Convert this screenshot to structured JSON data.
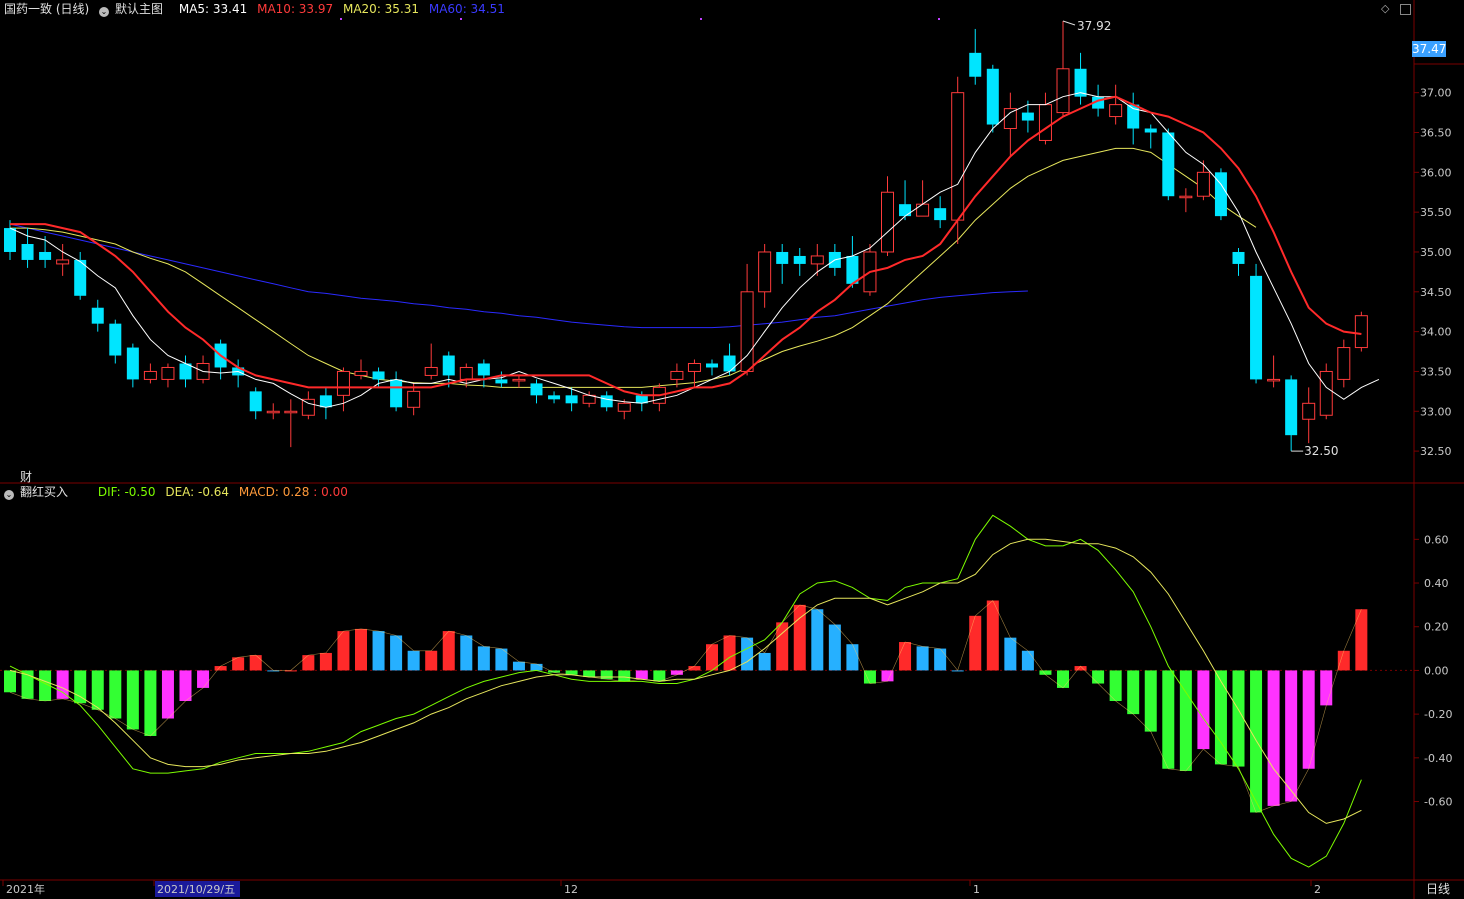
{
  "header": {
    "title": "国药一致 (日线)",
    "template": "默认主图",
    "ma5": "MA5: 33.41",
    "ma10": "MA10: 33.97",
    "ma20": "MA20: 35.31",
    "ma60": "MA60: 34.51"
  },
  "sub_header": {
    "indicator": "翻红买入",
    "dif": "DIF: -0.50",
    "dea": "DEA: -0.64",
    "macd": "MACD: 0.28",
    "extra": ": 0.00"
  },
  "current_price_tag": "37.47",
  "cai_label": "财",
  "annotations": {
    "high": "37.92",
    "low": "32.50"
  },
  "period_label": "日线",
  "date_axis": [
    "2021年",
    "2021/10/29/五",
    "12",
    "1",
    "2"
  ],
  "colors": {
    "up": "#ff3b3b",
    "down": "#00e5ff",
    "ma5": "#ffffff",
    "ma10": "#ff2a2a",
    "ma20": "#e6e65c",
    "ma60": "#2a2aff",
    "grid": "#7a0000",
    "dif": "#7cfc00",
    "dea": "#e6e65c",
    "macd_pos": "#ff2a2a",
    "macd_pos_dim": "#26b0ff",
    "macd_neg": "#33ff33",
    "macd_neg_dim": "#ff33ff"
  },
  "chart_data": [
    {
      "type": "candlestick",
      "title": "国药一致 (日线)",
      "y_ticks": [
        "37.00",
        "36.50",
        "36.00",
        "35.50",
        "35.00",
        "34.50",
        "34.00",
        "33.50",
        "33.00",
        "32.50"
      ],
      "ylim": [
        32.2,
        37.95
      ],
      "candles": [
        [
          35.3,
          35.0,
          35.4,
          34.9
        ],
        [
          35.1,
          34.9,
          35.3,
          34.8
        ],
        [
          35.0,
          34.9,
          35.2,
          34.8
        ],
        [
          34.85,
          34.9,
          35.1,
          34.7
        ],
        [
          34.9,
          34.45,
          35.0,
          34.4
        ],
        [
          34.3,
          34.1,
          34.4,
          34.0
        ],
        [
          34.1,
          33.7,
          34.15,
          33.6
        ],
        [
          33.8,
          33.4,
          33.85,
          33.3
        ],
        [
          33.4,
          33.5,
          33.6,
          33.35
        ],
        [
          33.4,
          33.55,
          33.6,
          33.3
        ],
        [
          33.6,
          33.4,
          33.7,
          33.3
        ],
        [
          33.4,
          33.6,
          33.7,
          33.35
        ],
        [
          33.85,
          33.55,
          33.9,
          33.4
        ],
        [
          33.55,
          33.45,
          33.65,
          33.3
        ],
        [
          33.25,
          33.0,
          33.3,
          32.9
        ],
        [
          33.0,
          33.0,
          33.1,
          32.9
        ],
        [
          33.0,
          33.0,
          33.15,
          32.55
        ],
        [
          32.95,
          33.15,
          33.25,
          32.9
        ],
        [
          33.2,
          33.05,
          33.3,
          32.9
        ],
        [
          33.2,
          33.5,
          33.55,
          33.0
        ],
        [
          33.45,
          33.5,
          33.65,
          33.4
        ],
        [
          33.5,
          33.4,
          33.55,
          33.3
        ],
        [
          33.4,
          33.05,
          33.5,
          33.0
        ],
        [
          33.05,
          33.25,
          33.35,
          32.95
        ],
        [
          33.45,
          33.55,
          33.85,
          33.4
        ],
        [
          33.7,
          33.45,
          33.75,
          33.3
        ],
        [
          33.4,
          33.55,
          33.6,
          33.3
        ],
        [
          33.6,
          33.45,
          33.65,
          33.3
        ],
        [
          33.4,
          33.35,
          33.5,
          33.3
        ],
        [
          33.4,
          33.4,
          33.45,
          33.3
        ],
        [
          33.35,
          33.2,
          33.4,
          33.1
        ],
        [
          33.2,
          33.15,
          33.25,
          33.1
        ],
        [
          33.2,
          33.1,
          33.3,
          33.0
        ],
        [
          33.1,
          33.2,
          33.25,
          33.05
        ],
        [
          33.2,
          33.05,
          33.25,
          33.0
        ],
        [
          33.0,
          33.1,
          33.15,
          32.9
        ],
        [
          33.2,
          33.1,
          33.25,
          33.0
        ],
        [
          33.1,
          33.3,
          33.35,
          33.0
        ],
        [
          33.4,
          33.5,
          33.6,
          33.3
        ],
        [
          33.5,
          33.6,
          33.65,
          33.3
        ],
        [
          33.6,
          33.55,
          33.65,
          33.45
        ],
        [
          33.7,
          33.5,
          33.85,
          33.45
        ],
        [
          33.5,
          34.5,
          34.85,
          33.45
        ],
        [
          34.5,
          35.0,
          35.1,
          34.3
        ],
        [
          35.0,
          34.85,
          35.1,
          34.6
        ],
        [
          34.95,
          34.85,
          35.05,
          34.7
        ],
        [
          34.85,
          34.95,
          35.1,
          34.7
        ],
        [
          35.0,
          34.8,
          35.1,
          34.7
        ],
        [
          34.95,
          34.6,
          35.2,
          34.55
        ],
        [
          34.5,
          35.0,
          35.1,
          34.45
        ],
        [
          35.0,
          35.75,
          35.95,
          34.95
        ],
        [
          35.6,
          35.45,
          35.9,
          35.4
        ],
        [
          35.45,
          35.6,
          35.9,
          35.45
        ],
        [
          35.55,
          35.4,
          35.7,
          35.3
        ],
        [
          35.4,
          37.0,
          37.2,
          35.1
        ],
        [
          37.5,
          37.2,
          37.8,
          37.1
        ],
        [
          37.3,
          36.6,
          37.35,
          36.5
        ],
        [
          36.55,
          36.8,
          37.0,
          36.2
        ],
        [
          36.75,
          36.65,
          36.9,
          36.5
        ],
        [
          36.4,
          36.85,
          37.0,
          36.35
        ],
        [
          36.75,
          37.3,
          37.9,
          36.7
        ],
        [
          37.3,
          36.95,
          37.5,
          36.85
        ],
        [
          36.95,
          36.8,
          37.1,
          36.7
        ],
        [
          36.7,
          36.85,
          37.1,
          36.6
        ],
        [
          36.85,
          36.55,
          37.0,
          36.35
        ],
        [
          36.55,
          36.5,
          36.6,
          36.3
        ],
        [
          36.5,
          35.7,
          36.55,
          35.65
        ],
        [
          35.7,
          35.7,
          35.8,
          35.5
        ],
        [
          35.7,
          36.0,
          36.15,
          35.65
        ],
        [
          36.0,
          35.45,
          36.05,
          35.4
        ],
        [
          35.0,
          34.85,
          35.05,
          34.7
        ],
        [
          34.7,
          33.4,
          34.85,
          33.35
        ],
        [
          33.4,
          33.4,
          33.7,
          33.3
        ],
        [
          33.4,
          32.7,
          33.45,
          32.5
        ],
        [
          32.9,
          33.1,
          33.3,
          32.6
        ],
        [
          32.95,
          33.5,
          33.6,
          32.9
        ],
        [
          33.4,
          33.8,
          33.9,
          33.3
        ],
        [
          33.8,
          34.2,
          34.25,
          33.75
        ]
      ],
      "ma5": [
        35.3,
        35.2,
        35.15,
        35.0,
        34.88,
        34.7,
        34.55,
        34.2,
        33.9,
        33.7,
        33.6,
        33.5,
        33.48,
        33.5,
        33.4,
        33.35,
        33.22,
        33.1,
        33.05,
        33.1,
        33.2,
        33.35,
        33.4,
        33.35,
        33.35,
        33.4,
        33.35,
        33.4,
        33.42,
        33.5,
        33.42,
        33.35,
        33.28,
        33.2,
        33.15,
        33.12,
        33.1,
        33.15,
        33.2,
        33.3,
        33.4,
        33.5,
        33.7,
        34.0,
        34.3,
        34.55,
        34.75,
        34.9,
        34.95,
        35.05,
        35.25,
        35.45,
        35.6,
        35.75,
        35.85,
        36.25,
        36.55,
        36.75,
        36.85,
        36.85,
        36.95,
        37.0,
        36.95,
        36.95,
        36.8,
        36.75,
        36.5,
        36.25,
        36.1,
        35.85,
        35.5,
        35.0,
        34.55,
        34.1,
        33.6,
        33.3,
        33.15,
        33.3,
        33.4
      ],
      "ma10": [
        35.35,
        35.35,
        35.35,
        35.3,
        35.25,
        35.1,
        34.95,
        34.75,
        34.5,
        34.25,
        34.05,
        33.9,
        33.7,
        33.55,
        33.45,
        33.4,
        33.35,
        33.3,
        33.3,
        33.3,
        33.3,
        33.3,
        33.3,
        33.3,
        33.3,
        33.35,
        33.4,
        33.4,
        33.45,
        33.45,
        33.45,
        33.45,
        33.45,
        33.45,
        33.35,
        33.25,
        33.2,
        33.2,
        33.25,
        33.3,
        33.3,
        33.35,
        33.5,
        33.7,
        33.9,
        34.05,
        34.25,
        34.4,
        34.6,
        34.75,
        34.8,
        34.9,
        34.95,
        35.1,
        35.4,
        35.7,
        35.95,
        36.2,
        36.4,
        36.55,
        36.7,
        36.8,
        36.9,
        36.95,
        36.85,
        36.75,
        36.7,
        36.6,
        36.5,
        36.3,
        36.05,
        35.7,
        35.25,
        34.75,
        34.3,
        34.1,
        34.0,
        33.97
      ],
      "ma20": [
        35.3,
        35.3,
        35.28,
        35.25,
        35.2,
        35.15,
        35.1,
        35.0,
        34.92,
        34.85,
        34.75,
        34.6,
        34.45,
        34.3,
        34.15,
        34.0,
        33.85,
        33.7,
        33.6,
        33.5,
        33.45,
        33.4,
        33.38,
        33.36,
        33.35,
        33.35,
        33.33,
        33.32,
        33.3,
        33.3,
        33.3,
        33.3,
        33.3,
        33.3,
        33.3,
        33.3,
        33.3,
        33.32,
        33.34,
        33.36,
        33.4,
        33.45,
        33.55,
        33.65,
        33.75,
        33.82,
        33.88,
        33.95,
        34.05,
        34.2,
        34.35,
        34.55,
        34.75,
        34.95,
        35.15,
        35.4,
        35.6,
        35.8,
        35.95,
        36.05,
        36.15,
        36.2,
        36.25,
        36.3,
        36.3,
        36.25,
        36.1,
        35.95,
        35.8,
        35.6,
        35.45,
        35.31
      ],
      "ma60": [
        35.35,
        35.3,
        35.25,
        35.2,
        35.15,
        35.1,
        35.05,
        35.0,
        34.95,
        34.9,
        34.85,
        34.8,
        34.75,
        34.7,
        34.65,
        34.6,
        34.55,
        34.5,
        34.48,
        34.45,
        34.42,
        34.4,
        34.38,
        34.35,
        34.33,
        34.3,
        34.28,
        34.25,
        34.23,
        34.2,
        34.18,
        34.15,
        34.12,
        34.1,
        34.08,
        34.06,
        34.05,
        34.05,
        34.05,
        34.05,
        34.05,
        34.06,
        34.08,
        34.1,
        34.12,
        34.15,
        34.18,
        34.2,
        34.24,
        34.28,
        34.32,
        34.36,
        34.4,
        34.43,
        34.45,
        34.47,
        34.49,
        34.5,
        34.51
      ]
    },
    {
      "type": "macd",
      "y_ticks": [
        "0.60",
        "0.40",
        "0.20",
        "0.00",
        "-0.20",
        "-0.40",
        "-0.60"
      ],
      "ylim": [
        -0.95,
        0.78
      ],
      "macd": [
        -0.1,
        -0.13,
        -0.14,
        -0.13,
        -0.15,
        -0.18,
        -0.22,
        -0.27,
        -0.3,
        -0.22,
        -0.14,
        -0.08,
        0.02,
        0.06,
        0.07,
        0.0,
        0.0,
        0.07,
        0.08,
        0.18,
        0.19,
        0.18,
        0.16,
        0.09,
        0.09,
        0.18,
        0.16,
        0.11,
        0.1,
        0.04,
        0.03,
        -0.01,
        -0.02,
        -0.03,
        -0.04,
        -0.05,
        -0.04,
        -0.05,
        -0.02,
        0.02,
        0.12,
        0.16,
        0.15,
        0.08,
        0.22,
        0.3,
        0.28,
        0.21,
        0.12,
        -0.06,
        -0.05,
        0.13,
        0.11,
        0.1,
        0.0,
        0.25,
        0.32,
        0.15,
        0.09,
        -0.02,
        -0.08,
        0.02,
        -0.06,
        -0.14,
        -0.2,
        -0.28,
        -0.45,
        -0.46,
        -0.36,
        -0.43,
        -0.44,
        -0.65,
        -0.62,
        -0.6,
        -0.45,
        -0.16,
        0.09,
        0.28
      ],
      "dif": [
        0.02,
        -0.02,
        -0.06,
        -0.1,
        -0.16,
        -0.25,
        -0.35,
        -0.45,
        -0.47,
        -0.47,
        -0.46,
        -0.45,
        -0.42,
        -0.4,
        -0.38,
        -0.38,
        -0.38,
        -0.37,
        -0.35,
        -0.33,
        -0.28,
        -0.25,
        -0.22,
        -0.2,
        -0.16,
        -0.12,
        -0.08,
        -0.05,
        -0.03,
        -0.01,
        0.0,
        -0.02,
        -0.04,
        -0.05,
        -0.05,
        -0.05,
        -0.05,
        -0.06,
        -0.06,
        -0.04,
        0.0,
        0.06,
        0.1,
        0.14,
        0.22,
        0.35,
        0.4,
        0.41,
        0.38,
        0.33,
        0.32,
        0.38,
        0.4,
        0.4,
        0.42,
        0.6,
        0.71,
        0.66,
        0.6,
        0.57,
        0.57,
        0.6,
        0.55,
        0.46,
        0.36,
        0.2,
        0.02,
        -0.1,
        -0.22,
        -0.33,
        -0.45,
        -0.6,
        -0.75,
        -0.86,
        -0.9,
        -0.85,
        -0.7,
        -0.5
      ],
      "dea": [
        0.0,
        -0.02,
        -0.05,
        -0.08,
        -0.12,
        -0.17,
        -0.24,
        -0.32,
        -0.4,
        -0.43,
        -0.44,
        -0.44,
        -0.43,
        -0.41,
        -0.4,
        -0.39,
        -0.38,
        -0.38,
        -0.37,
        -0.35,
        -0.33,
        -0.3,
        -0.27,
        -0.24,
        -0.2,
        -0.17,
        -0.13,
        -0.1,
        -0.07,
        -0.05,
        -0.03,
        -0.02,
        -0.02,
        -0.03,
        -0.03,
        -0.03,
        -0.04,
        -0.05,
        -0.04,
        -0.04,
        -0.02,
        0.0,
        0.04,
        0.1,
        0.17,
        0.24,
        0.3,
        0.33,
        0.33,
        0.33,
        0.3,
        0.33,
        0.36,
        0.4,
        0.4,
        0.44,
        0.53,
        0.58,
        0.6,
        0.6,
        0.59,
        0.58,
        0.58,
        0.56,
        0.52,
        0.45,
        0.35,
        0.22,
        0.09,
        -0.05,
        -0.18,
        -0.32,
        -0.45,
        -0.55,
        -0.65,
        -0.7,
        -0.68,
        -0.64
      ]
    }
  ]
}
